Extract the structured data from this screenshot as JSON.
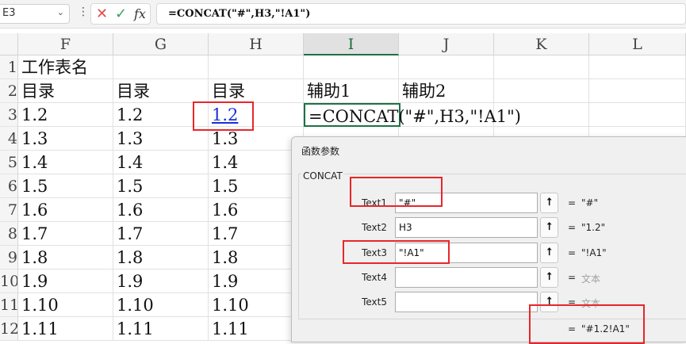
{
  "formula_bar": {
    "name_box": "E3",
    "formula": "=CONCAT(\"#\",H3,\"!A1\")",
    "cancel_icon": "✕",
    "confirm_icon": "✓",
    "fx_label": "fx"
  },
  "columns": [
    "F",
    "G",
    "H",
    "I",
    "J",
    "K",
    "L"
  ],
  "selected_column": "I",
  "rows": [
    {
      "num": "1",
      "F": "工作表名",
      "G": "",
      "H": "",
      "I": "",
      "J": ""
    },
    {
      "num": "2",
      "F": "目录",
      "G": "目录",
      "H": "目录",
      "I": "辅助1",
      "J": "辅助2"
    },
    {
      "num": "3",
      "F": "1.2",
      "G": "1.2",
      "H": "1.2",
      "I": "=CONCAT(\"#\",H3,\"!A1\")",
      "J": ""
    },
    {
      "num": "4",
      "F": "1.3",
      "G": "1.3",
      "H": "1.3"
    },
    {
      "num": "5",
      "F": "1.4",
      "G": "1.4",
      "H": "1.4"
    },
    {
      "num": "6",
      "F": "1.5",
      "G": "1.5",
      "H": "1.5"
    },
    {
      "num": "7",
      "F": "1.6",
      "G": "1.6",
      "H": "1.6"
    },
    {
      "num": "8",
      "F": "1.7",
      "G": "1.7",
      "H": "1.7"
    },
    {
      "num": "9",
      "F": "1.8",
      "G": "1.8",
      "H": "1.8"
    },
    {
      "num": "10",
      "F": "1.9",
      "G": "1.9",
      "H": "1.9"
    },
    {
      "num": "11",
      "F": "1.10",
      "G": "1.10",
      "H": "1.10"
    },
    {
      "num": "12",
      "F": "1.11",
      "G": "1.11",
      "H": "1.11"
    }
  ],
  "dialog": {
    "title": "函数参数",
    "function_name": "CONCAT",
    "args": [
      {
        "label": "Text1",
        "value": "\"#\"",
        "result": "\"#\"",
        "placeholder": false
      },
      {
        "label": "Text2",
        "value": "H3",
        "result": "\"1.2\"",
        "placeholder": false
      },
      {
        "label": "Text3",
        "value": "\"!A1\"",
        "result": "\"!A1\"",
        "placeholder": false
      },
      {
        "label": "Text4",
        "value": "",
        "result": "文本",
        "placeholder": true
      },
      {
        "label": "Text5",
        "value": "",
        "result": "文本",
        "placeholder": true
      }
    ],
    "equals": "=",
    "collapse_icon": "⭡",
    "final_result": "\"#1.2!A1\""
  },
  "colors": {
    "highlight": "#e8262a",
    "link": "#1a2fd8",
    "selection": "#1e7145"
  }
}
